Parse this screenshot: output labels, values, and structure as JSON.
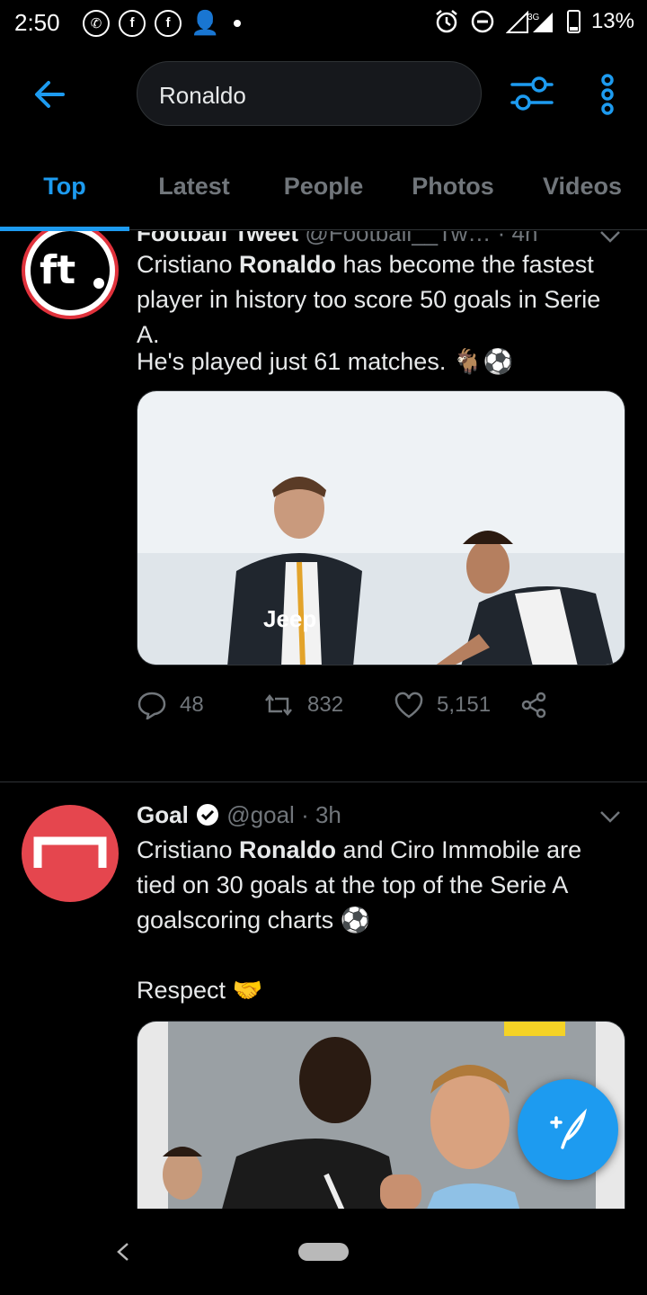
{
  "status_bar": {
    "time": "2:50",
    "battery": "13%",
    "network": "3G"
  },
  "search": {
    "query": "Ronaldo"
  },
  "tabs": [
    {
      "label": "Top",
      "active": true
    },
    {
      "label": "Latest",
      "active": false
    },
    {
      "label": "People",
      "active": false
    },
    {
      "label": "Photos",
      "active": false
    },
    {
      "label": "Videos",
      "active": false
    }
  ],
  "tweets": [
    {
      "name": "Football Tweet",
      "handle": "@Football__Tw…",
      "time": "4h",
      "avatar_text": "ft",
      "text_pre": "Cristiano ",
      "text_bold": "Ronaldo",
      "text_post": " has become the fastest player in history too score 50 goals in Serie A.",
      "text_line2": "He's played just 61 matches. 🐐⚽",
      "replies": "48",
      "retweets": "832",
      "likes": "5,151"
    },
    {
      "name": "Goal",
      "handle": "@goal",
      "time": "3h",
      "text_pre": "Cristiano ",
      "text_bold": "Ronaldo",
      "text_post": " and Ciro Immobile are tied on 30 goals at the top of the Serie A goalscoring charts ⚽",
      "text_line2": "Respect 🤝"
    }
  ],
  "colors": {
    "accent": "#1d9bf0",
    "goal_avatar": "#e5464e",
    "ft_avatar_ring": "#e0323c"
  }
}
